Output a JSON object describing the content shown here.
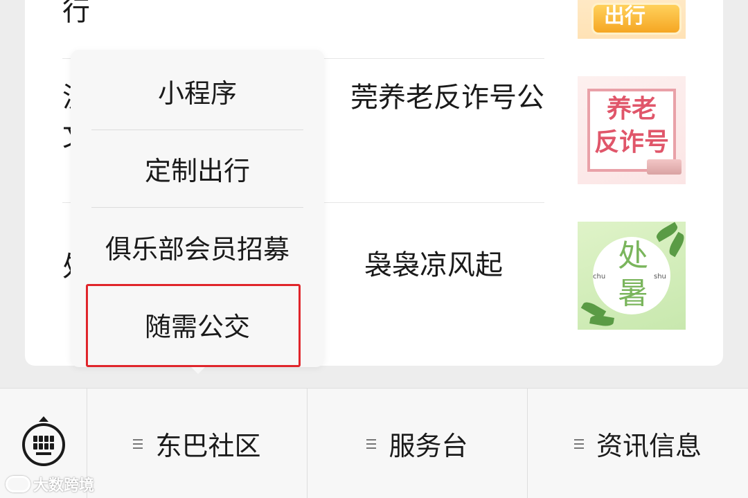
{
  "articles": [
    {
      "title_fragment": "行"
    },
    {
      "title_visible": "莞养老反诈号公",
      "title_line2_fragment": "文",
      "title_leading_fragment": "沪"
    },
    {
      "title_visible": "袅袅凉风起",
      "title_leading_fragment": "处"
    }
  ],
  "thumbnails": {
    "t1": {
      "icon": "travel-banner",
      "text": "出行"
    },
    "t2": {
      "icon": "elderly-anti-fraud-poster",
      "line1": "养老",
      "line2": "反诈号"
    },
    "t3": {
      "icon": "chushu-solar-term-poster",
      "line1": "处",
      "line2": "暑",
      "pinyin1": "chu",
      "pinyin2": "shu"
    }
  },
  "popup_menu": {
    "items": [
      {
        "label": "小程序"
      },
      {
        "label": "定制出行"
      },
      {
        "label": "俱乐部会员招募"
      },
      {
        "label": "随需公交"
      }
    ],
    "highlighted_item": "随需公交",
    "highlight_color": "#e0252b"
  },
  "bottom_menu": {
    "keyboard_icon": "keyboard-icon",
    "tabs": [
      {
        "label": "东巴社区",
        "icon": "menu-lines-icon"
      },
      {
        "label": "服务台",
        "icon": "menu-lines-icon"
      },
      {
        "label": "资讯信息",
        "icon": "menu-lines-icon"
      }
    ]
  },
  "watermark": {
    "text": "大数跨境"
  }
}
